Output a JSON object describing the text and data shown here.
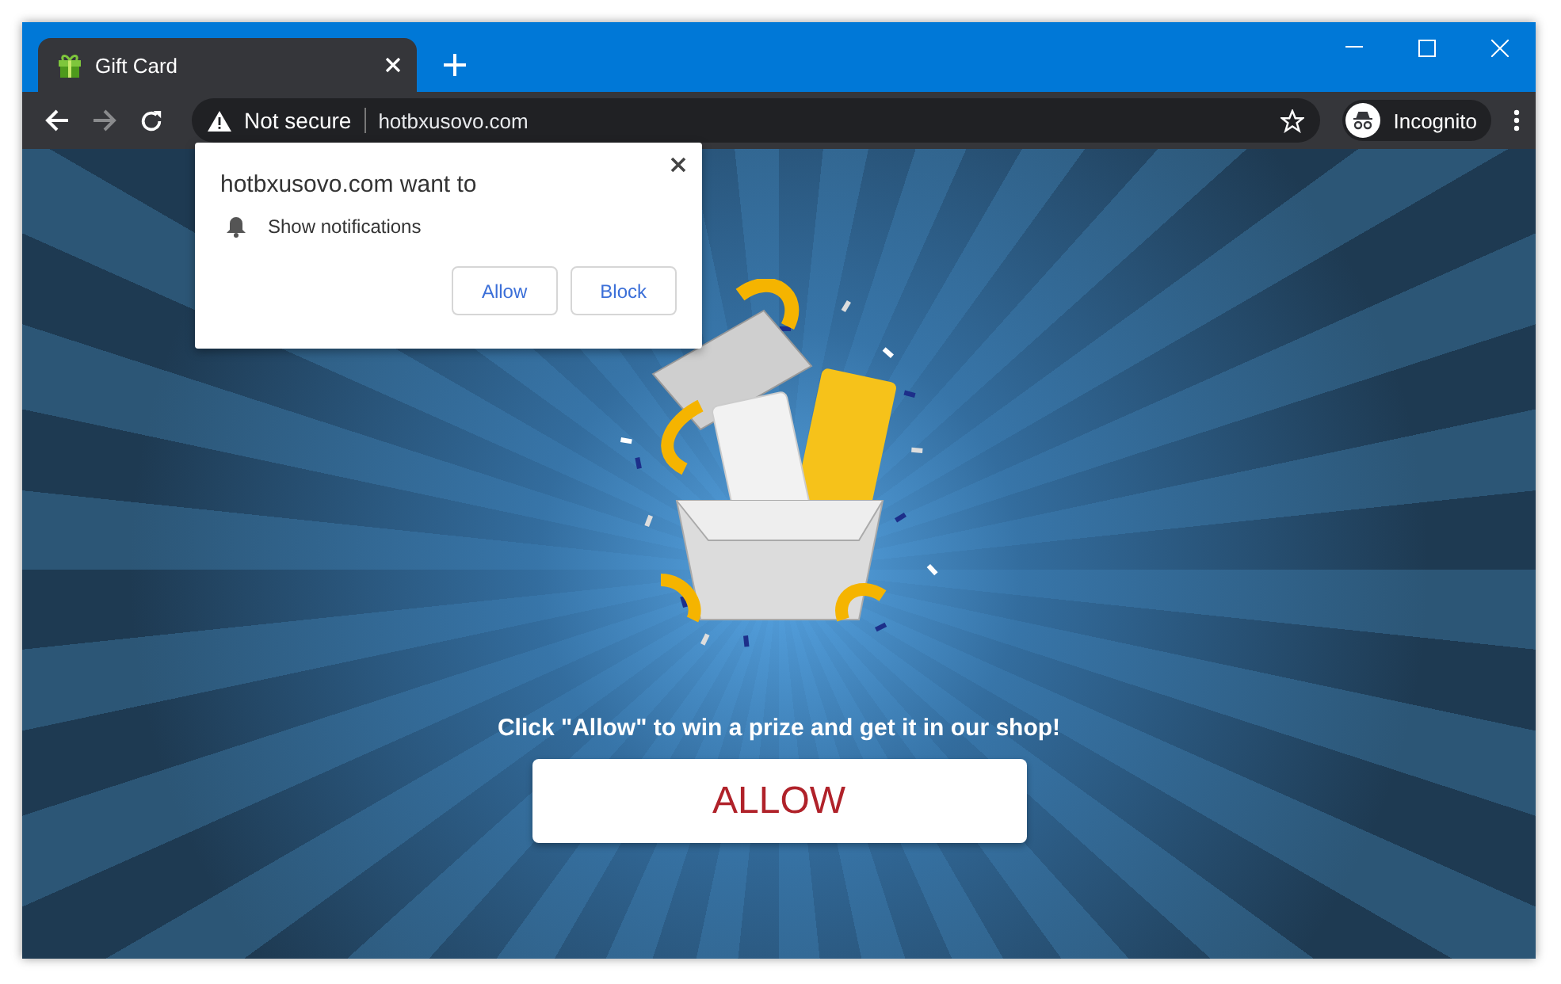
{
  "tab": {
    "title": "Gift Card",
    "selected": true
  },
  "address_bar": {
    "security": "Not secure",
    "url": "hotbxusovo.com"
  },
  "profile": {
    "label": "Incognito"
  },
  "permission_prompt": {
    "title": "hotbxusovo.com want to",
    "permission": "Show notifications",
    "buttons": [
      "Allow",
      "Block"
    ]
  },
  "page": {
    "message": "Click \"Allow\" to win a prize and get it in our shop!",
    "button": "ALLOW"
  }
}
